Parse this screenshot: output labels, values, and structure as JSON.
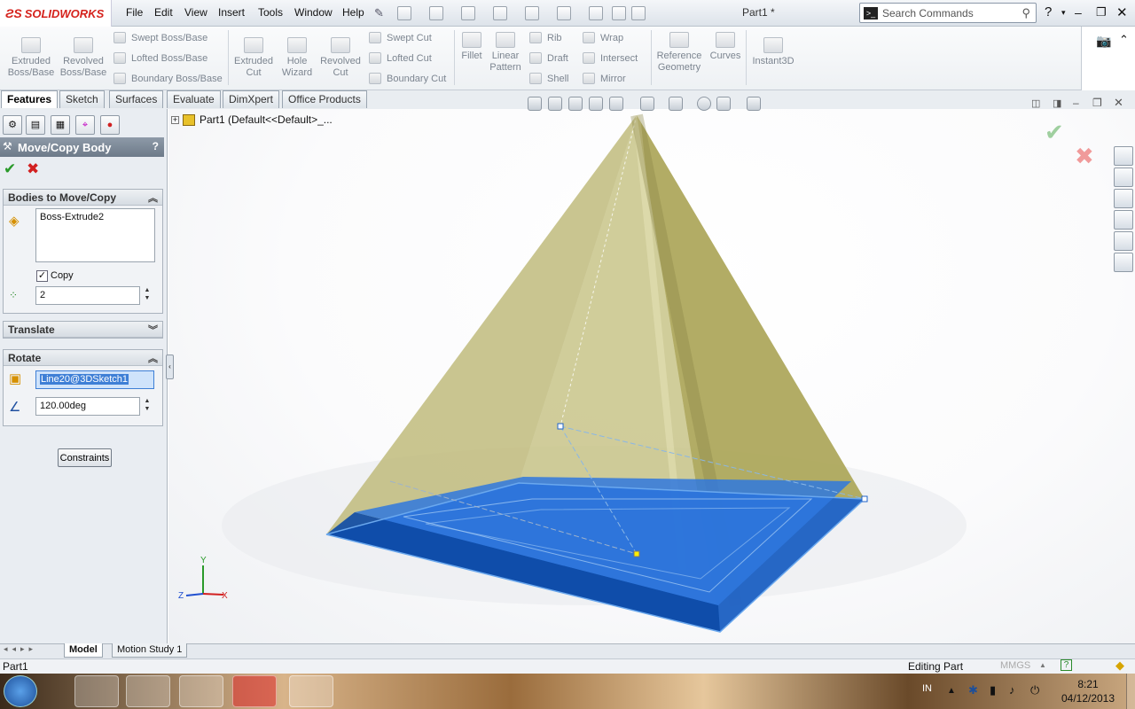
{
  "app": {
    "logo": "SOLIDWORKS",
    "doc_title": "Part1 *"
  },
  "menus": [
    "File",
    "Edit",
    "View",
    "Insert",
    "Tools",
    "Window",
    "Help"
  ],
  "search": {
    "placeholder": "Search Commands"
  },
  "ribbon": {
    "extruded_boss": "Extruded Boss/Base",
    "revolved_boss": "Revolved Boss/Base",
    "swept_boss": "Swept Boss/Base",
    "lofted_boss": "Lofted Boss/Base",
    "boundary_boss": "Boundary Boss/Base",
    "extruded_cut": "Extruded Cut",
    "hole_wizard": "Hole Wizard",
    "revolved_cut": "Revolved Cut",
    "swept_cut": "Swept Cut",
    "lofted_cut": "Lofted Cut",
    "boundary_cut": "Boundary Cut",
    "fillet": "Fillet",
    "linear_pattern": "Linear Pattern",
    "rib": "Rib",
    "draft": "Draft",
    "shell": "Shell",
    "wrap": "Wrap",
    "intersect": "Intersect",
    "mirror": "Mirror",
    "reference_geometry": "Reference Geometry",
    "curves": "Curves",
    "instant3d": "Instant3D"
  },
  "tabs": [
    "Features",
    "Sketch",
    "Surfaces",
    "Evaluate",
    "DimXpert",
    "Office Products"
  ],
  "property_manager": {
    "title": "Move/Copy Body",
    "help": "?",
    "bodies_group": "Bodies to Move/Copy",
    "body_item": "Boss-Extrude2",
    "copy_label": "Copy",
    "copy_checked": true,
    "copies": "2",
    "translate_group": "Translate",
    "rotate_group": "Rotate",
    "rotate_axis": "Line20@3DSketch1",
    "rotate_angle": "120.00deg",
    "constraints_button": "Constraints"
  },
  "tree": {
    "root": "Part1  (Default<<Default>_..."
  },
  "triad": {
    "x": "X",
    "y": "Y",
    "z": "Z"
  },
  "bottom_tabs": [
    "Model",
    "Motion Study 1"
  ],
  "status": {
    "left": "Part1",
    "mode": "Editing Part",
    "units": "MMGS",
    "units_arrow": "▲"
  },
  "taskbar": {
    "lang": "IN",
    "time": "8:21",
    "date": "04/12/2013"
  },
  "colors": {
    "accent_blue": "#1f63c9",
    "pyramid_yellow": "#bdb86a",
    "ok_green": "#2a9a2a",
    "cancel_red": "#d22020"
  }
}
